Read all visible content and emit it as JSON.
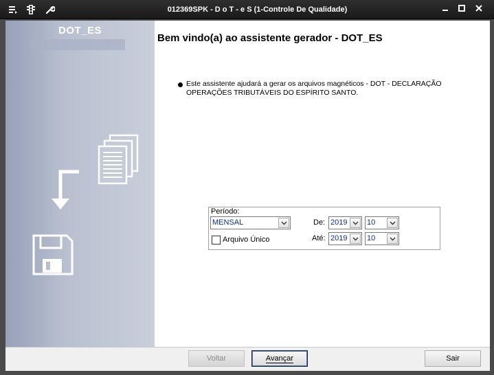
{
  "window": {
    "title": "012369SPK - D o T - e S (1-Controle De Qualidade)",
    "icons": [
      "menu-list-icon",
      "traffic-light-icon",
      "wrench-icon"
    ],
    "controls": {
      "minimize": "▬",
      "maximize": "▢",
      "close": "✕"
    }
  },
  "sidebar": {
    "brand": "DOT_ES",
    "icons": [
      "documents-stack-icon",
      "down-arrow-icon",
      "floppy-disk-icon"
    ]
  },
  "main": {
    "heading": "Bem vindo(a) ao assistente gerador - DOT_ES",
    "intro": "Este assistente ajudará a gerar os arquivos magnéticos - DOT - DECLARAÇÃO OPERAÇÕES TRIBUTÁVEIS DO ESPÍRITO SANTO."
  },
  "period": {
    "label": "Período:",
    "type_value": "MENSAL",
    "single_file_label": "Arquivo Único",
    "single_file_checked": false,
    "from_label": "De:",
    "from_year": "2019",
    "from_month": "10",
    "to_label": "Até:",
    "to_year": "2019",
    "to_month": "10"
  },
  "buttons": {
    "back": "Voltar",
    "next": "Avançar",
    "exit": "Sair"
  },
  "colors": {
    "titlebar": "#1f1f1f",
    "sidebar": "#b8c0d0",
    "combo_text": "#0a2fa3"
  }
}
